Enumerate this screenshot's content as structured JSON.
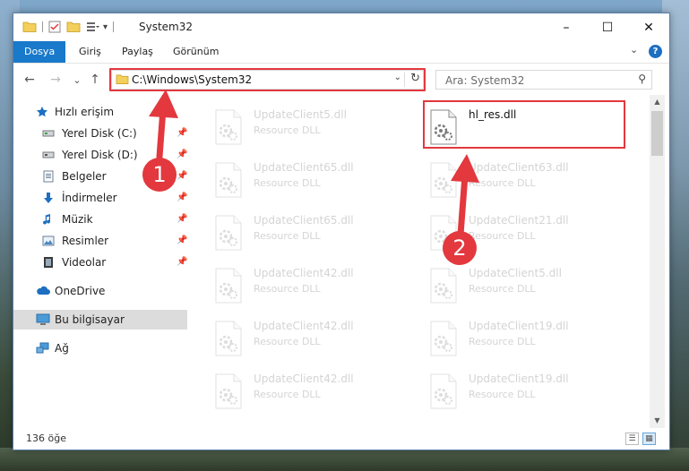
{
  "window": {
    "title": "System32",
    "controls": {
      "minimize": "–",
      "maximize": "☐",
      "close": "✕"
    }
  },
  "ribbon": {
    "tabs": [
      "Dosya",
      "Giriş",
      "Paylaş",
      "Görünüm"
    ],
    "expand_icon": "chevron-down-icon",
    "help_label": "?"
  },
  "nav": {
    "back": "←",
    "forward": "→",
    "recent": "⌄",
    "up": "↑",
    "address": "C:\\Windows\\System32",
    "search_placeholder": "Ara: System32"
  },
  "sidebar": {
    "items": [
      {
        "label": "Hızlı erişim",
        "icon": "star-icon",
        "pinned": false
      },
      {
        "label": "Yerel Disk (C:)",
        "icon": "drive-icon",
        "pinned": true
      },
      {
        "label": "Yerel Disk (D:)",
        "icon": "drive-icon",
        "pinned": true
      },
      {
        "label": "Belgeler",
        "icon": "documents-icon",
        "pinned": true
      },
      {
        "label": "İndirmeler",
        "icon": "download-icon",
        "pinned": true
      },
      {
        "label": "Müzik",
        "icon": "music-icon",
        "pinned": true
      },
      {
        "label": "Resimler",
        "icon": "pictures-icon",
        "pinned": true
      },
      {
        "label": "Videolar",
        "icon": "video-icon",
        "pinned": true
      },
      {
        "label": "OneDrive",
        "icon": "cloud-icon",
        "pinned": false
      },
      {
        "label": "Bu bilgisayar",
        "icon": "computer-icon",
        "pinned": false,
        "selected": true
      },
      {
        "label": "Ağ",
        "icon": "network-icon",
        "pinned": false
      }
    ]
  },
  "files": {
    "left": [
      {
        "name": "UpdateClient5.dll",
        "type": "Resource DLL"
      },
      {
        "name": "UpdateClient65.dll",
        "type": "Resource DLL"
      },
      {
        "name": "UpdateClient65.dll",
        "type": "Resource DLL"
      },
      {
        "name": "UpdateClient42.dll",
        "type": "Resource DLL"
      },
      {
        "name": "UpdateClient42.dll",
        "type": "Resource DLL"
      },
      {
        "name": "UpdateClient42.dll",
        "type": "Resource DLL"
      }
    ],
    "right": [
      {
        "name": "hl_res.dll",
        "type": ""
      },
      {
        "name": "UpdateClient63.dll",
        "type": "Resource DLL"
      },
      {
        "name": "UpdateClient21.dll",
        "type": "Resource DLL"
      },
      {
        "name": "UpdateClient5.dll",
        "type": "Resource DLL"
      },
      {
        "name": "UpdateClient19.dll",
        "type": "Resource DLL"
      },
      {
        "name": "UpdateClient19.dll",
        "type": "Resource DLL"
      }
    ]
  },
  "status": {
    "count": "136 öğe"
  },
  "callouts": {
    "first": "1",
    "second": "2"
  },
  "colors": {
    "accent": "#1979ca",
    "highlight": "#e2383e",
    "selected": "#dcdcdc"
  }
}
